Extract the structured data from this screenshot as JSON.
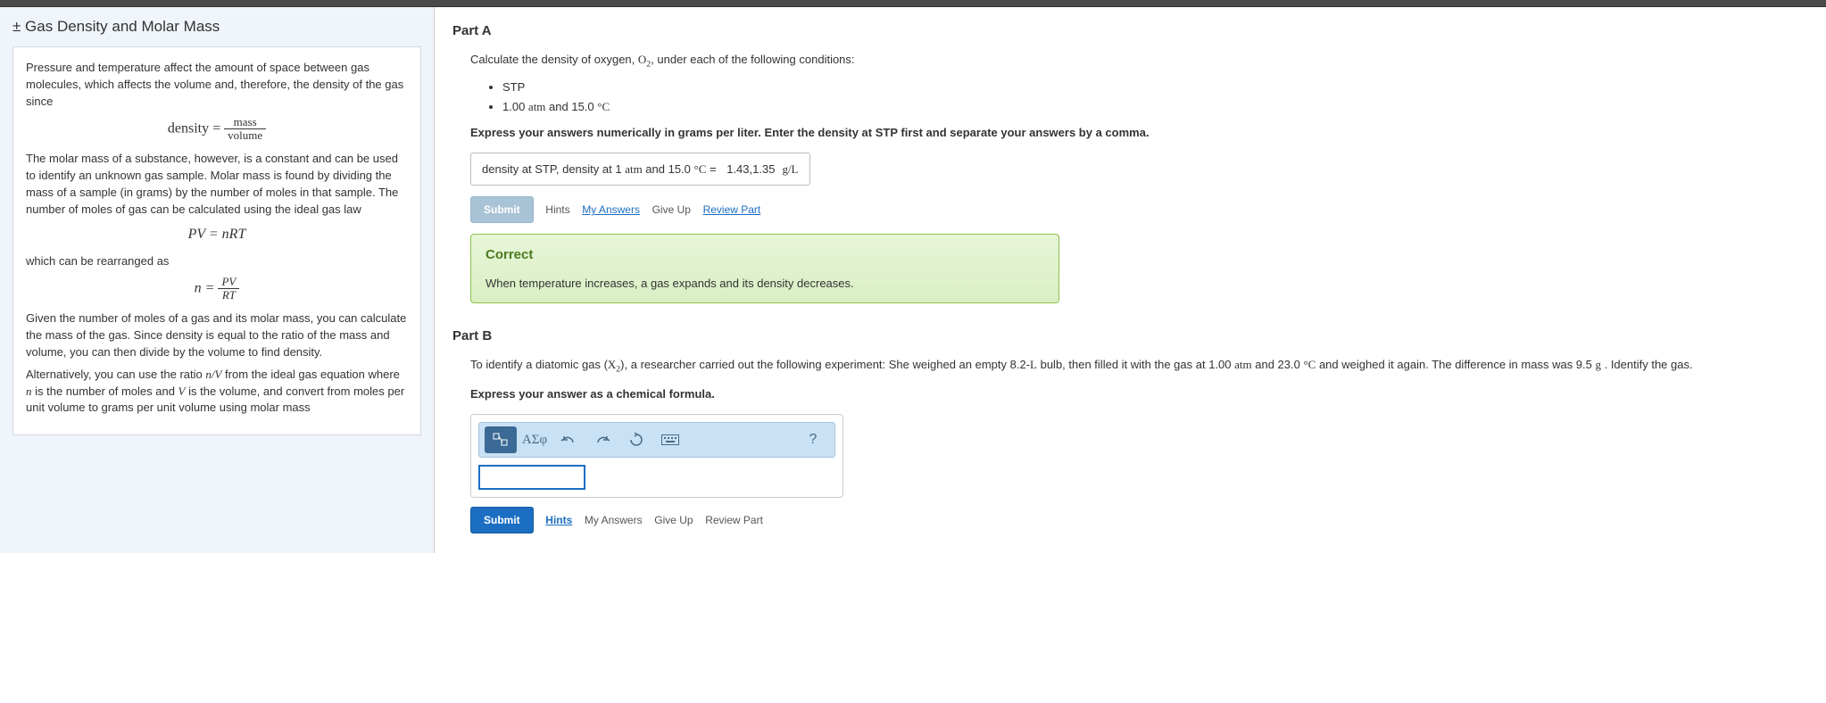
{
  "left": {
    "title": "± Gas Density and Molar Mass",
    "p1": "Pressure and temperature affect the amount of space between gas molecules, which affects the volume and, therefore, the density of the gas since",
    "eq_density_lhs": "density",
    "eq_eq": " = ",
    "eq_density_num": "mass",
    "eq_density_den": "volume",
    "p2": "The molar mass of a substance, however, is a constant and can be used to identify an unknown gas sample. Molar mass is found by dividing the mass of a sample (in grams) by the number of moles in that sample. The number of moles of gas can be calculated using the ideal gas law",
    "eq_ideal": "PV = nRT",
    "p3": "which can be rearranged as",
    "eq_n_lhs": "n = ",
    "eq_n_num": "PV",
    "eq_n_den": "RT",
    "p4": "Given the number of moles of a gas and its molar mass, you can calculate the mass of the gas. Since density is equal to the ratio of the mass and volume, you can then divide by the volume to find density.",
    "p5a": "Alternatively, you can use the ratio ",
    "p5ratio": "n/V",
    "p5b": " from the ideal gas equation where ",
    "p5n": "n",
    "p5c": " is the number of moles and ",
    "p5V": "V",
    "p5d": " is the volume, and convert from moles per unit volume to grams per unit volume using molar mass"
  },
  "partA": {
    "title": "Part A",
    "prompt_a": "Calculate the density of oxygen, ",
    "prompt_formula": "O",
    "prompt_sub": "2",
    "prompt_b": ", under each of the following conditions:",
    "bullet1": "STP",
    "bullet2a": "1.00 ",
    "bullet2b": "atm",
    "bullet2c": " and 15.0 ",
    "bullet2d": "°C",
    "instruct": "Express your answers numerically in grams per liter. Enter the density at STP first and separate your answers by a comma.",
    "answer_label_a": "density at STP, density at 1 ",
    "answer_label_b": "atm",
    "answer_label_c": " and 15.0 ",
    "answer_label_d": "°C",
    "answer_label_e": " = ",
    "answer_value": "1.43,1.35",
    "answer_unit": "g/L",
    "submit": "Submit",
    "hints": "Hints",
    "myanswers": "My Answers",
    "giveup": "Give Up",
    "review": "Review Part",
    "fb_title": "Correct",
    "fb_text": "When temperature increases, a gas expands and its density decreases."
  },
  "partB": {
    "title": "Part B",
    "prompt_a": "To identify a diatomic gas (",
    "prompt_x": "X",
    "prompt_sub": "2",
    "prompt_b": "), a researcher carried out the following experiment: She weighed an empty 8.2-",
    "prompt_L": "L",
    "prompt_c": " bulb, then filled it with the gas at 1.00 ",
    "prompt_atm": "atm",
    "prompt_d": " and 23.0 ",
    "prompt_degC": "°C",
    "prompt_e": " and weighed it again. The difference in mass was 9.5 ",
    "prompt_g": "g",
    "prompt_f": " . Identify the gas.",
    "instruct": "Express your answer as a chemical formula.",
    "greek": "ΑΣφ",
    "help": "?",
    "submit": "Submit",
    "hints": "Hints",
    "myanswers": "My Answers",
    "giveup": "Give Up",
    "review": "Review Part"
  }
}
